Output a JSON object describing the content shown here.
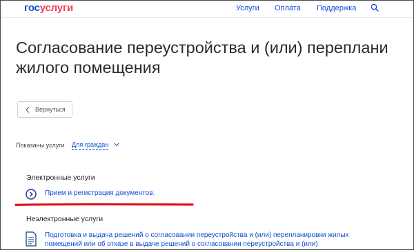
{
  "header": {
    "logo_part1": "гос",
    "logo_part2": "услуги",
    "nav": {
      "services": "Услуги",
      "payment": "Оплата",
      "support": "Поддержка"
    },
    "search_icon": "search-icon"
  },
  "page": {
    "title_line1": "Согласование переустройства и (или) переплани",
    "title_line2": "жилого помещения"
  },
  "back_button": {
    "label": "Вернуться",
    "icon": "chevron-left-icon"
  },
  "filter": {
    "label": "Показаны услуги",
    "selected": "Для граждан",
    "icon": "chevron-down-icon"
  },
  "electronic": {
    "heading": "Электронные услуги",
    "items": [
      {
        "label": "Прием и регистрация документов.",
        "icon": "arrow-circle-right-icon"
      }
    ]
  },
  "non_electronic": {
    "heading": "Неэлектронные услуги",
    "items": [
      {
        "line1": "Подготовка и выдача решений о согласовании переустройства и (или) перепланировки жилых",
        "line2": "помещений или об отказе в выдаче решений о согласовании переустройства и (или)",
        "icon": "document-icon"
      }
    ]
  },
  "colors": {
    "brand_blue": "#0d4cd3",
    "brand_red": "#ee3f58",
    "annotation_underline": "#e3151a",
    "title_text": "#2b2b2b"
  }
}
